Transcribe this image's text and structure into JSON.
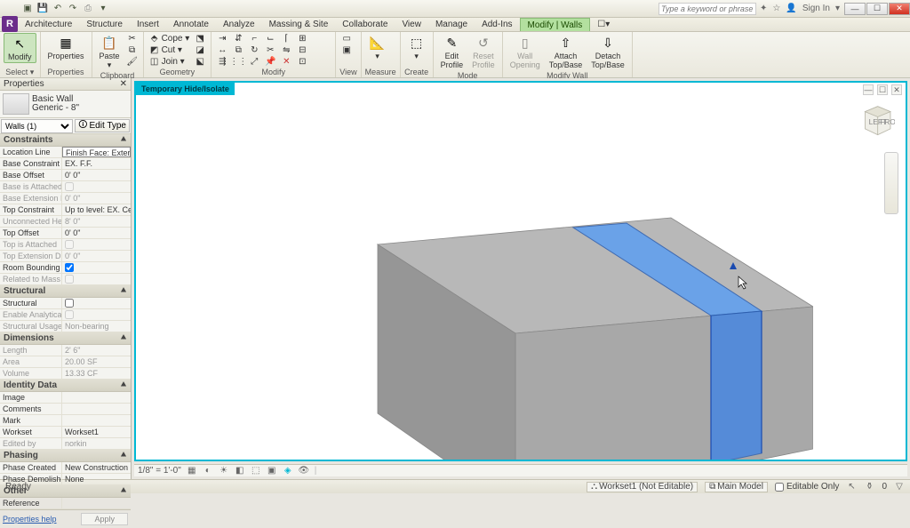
{
  "titlebar": {
    "search_placeholder": "Type a keyword or phrase",
    "signin": "Sign In"
  },
  "menu": {
    "tabs": [
      "Architecture",
      "Structure",
      "Insert",
      "Annotate",
      "Analyze",
      "Massing & Site",
      "Collaborate",
      "View",
      "Manage",
      "Add-Ins",
      "Modify | Walls"
    ]
  },
  "ribbon": {
    "select": {
      "modify": "Modify",
      "label": "Select ▾"
    },
    "properties": {
      "btn": "Properties",
      "label": "Properties"
    },
    "clipboard": {
      "paste": "Paste",
      "label": "Clipboard"
    },
    "geometry": {
      "cope": "Cope ▾",
      "cut": "Cut ▾",
      "join": "Join ▾",
      "label": "Geometry"
    },
    "modify": {
      "label": "Modify"
    },
    "view": {
      "label": "View"
    },
    "measure": {
      "label": "Measure"
    },
    "create": {
      "label": "Create"
    },
    "mode": {
      "edit": "Edit",
      "reset": "Reset",
      "p1": "Profile",
      "p2": "Profile",
      "label": "Mode"
    },
    "modifywall": {
      "wall": "Wall",
      "attach": "Attach",
      "detach": "Detach",
      "opening": "Opening",
      "tb1": "Top/Base",
      "tb2": "Top/Base",
      "label": "Modify Wall"
    }
  },
  "props": {
    "panel_title": "Properties",
    "type_family": "Basic Wall",
    "type_name": "Generic - 8\"",
    "category": "Walls (1)",
    "edit_type": "Edit Type",
    "groups": {
      "constraints": "Constraints",
      "structural": "Structural",
      "dimensions": "Dimensions",
      "identity": "Identity Data",
      "phasing": "Phasing",
      "other": "Other"
    },
    "rows": {
      "location_line_k": "Location Line",
      "location_line_v": "Finish Face: Exterior",
      "base_constraint_k": "Base Constraint",
      "base_constraint_v": "EX. F.F.",
      "base_offset_k": "Base Offset",
      "base_offset_v": "0'  0\"",
      "base_attached_k": "Base is Attached",
      "base_attached_v": "",
      "base_ext_k": "Base Extension Distance",
      "base_ext_v": "0'  0\"",
      "top_constraint_k": "Top Constraint",
      "top_constraint_v": "Up to level: EX. Ceili...",
      "unconn_height_k": "Unconnected Height",
      "unconn_height_v": "8'  0\"",
      "top_offset_k": "Top Offset",
      "top_offset_v": "0'  0\"",
      "top_attached_k": "Top is Attached",
      "top_attached_v": "",
      "top_ext_k": "Top Extension Distance",
      "top_ext_v": "0'  0\"",
      "room_bounding_k": "Room Bounding",
      "related_mass_k": "Related to Mass",
      "structural_k": "Structural",
      "enable_am_k": "Enable Analytical Model",
      "struct_usage_k": "Structural Usage",
      "struct_usage_v": "Non-bearing",
      "length_k": "Length",
      "length_v": "2'  6\"",
      "area_k": "Area",
      "area_v": "20.00 SF",
      "volume_k": "Volume",
      "volume_v": "13.33 CF",
      "image_k": "Image",
      "image_v": "",
      "comments_k": "Comments",
      "comments_v": "",
      "mark_k": "Mark",
      "mark_v": "",
      "workset_k": "Workset",
      "workset_v": "Workset1",
      "editedby_k": "Edited by",
      "editedby_v": "norkin",
      "phase_created_k": "Phase Created",
      "phase_created_v": "New Construction",
      "phase_demo_k": "Phase Demolished",
      "phase_demo_v": "None",
      "reference_k": "Reference",
      "reference_v": ""
    },
    "help": "Properties help",
    "apply": "Apply"
  },
  "view": {
    "temp_iso": "Temporary Hide/Isolate",
    "scale": "1/8\" = 1'-0\"",
    "cube_left": "LEFT",
    "cube_front": "FRONT"
  },
  "status": {
    "ready": "Ready",
    "workset": "Workset1 (Not Editable)",
    "mainmodel": "Main Model",
    "editable": "Editable Only",
    "zero": "0"
  }
}
